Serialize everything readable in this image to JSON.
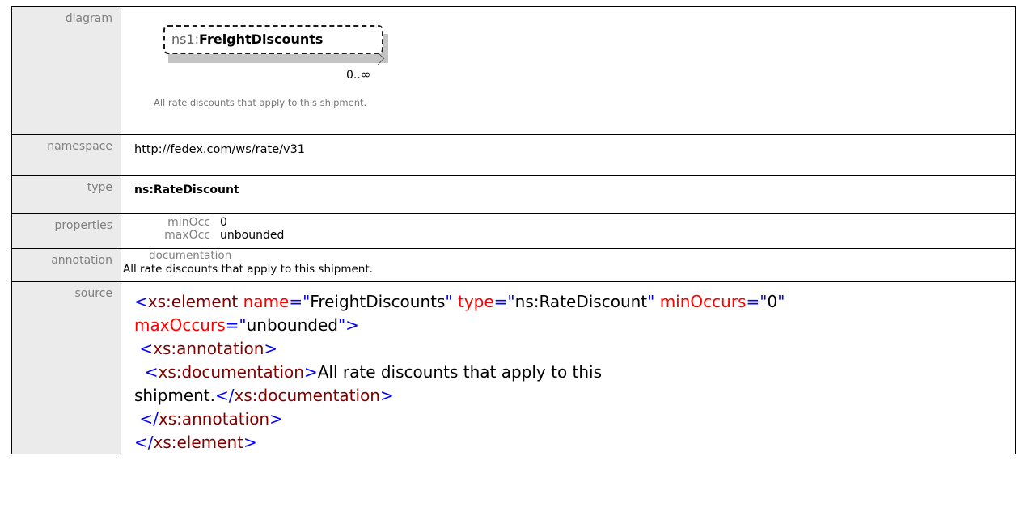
{
  "labels": {
    "diagram": "diagram",
    "namespace": "namespace",
    "type": "type",
    "properties": "properties",
    "annotation": "annotation",
    "source": "source"
  },
  "diagram": {
    "prefix": "ns1:",
    "name": "FreightDiscounts",
    "occurrence_min": "0..",
    "occurrence_max": "∞",
    "caption": "All rate discounts that apply to this shipment."
  },
  "namespace": "http://fedex.com/ws/rate/v31",
  "type": "ns:RateDiscount",
  "properties": {
    "minOcc_label": "minOcc",
    "minOcc_value": "0",
    "maxOcc_label": "maxOcc",
    "maxOcc_value": "unbounded"
  },
  "annotation": {
    "heading": "documentation",
    "text": "All rate discounts that apply to this shipment."
  },
  "source": {
    "element_open": "xs:element",
    "attr_name": "name",
    "val_name": "FreightDiscounts",
    "attr_type": "type",
    "val_type": "ns:RateDiscount",
    "attr_min": "minOccurs",
    "val_min": "0",
    "attr_max": "maxOccurs",
    "val_max": "unbounded",
    "annotation_tag": "xs:annotation",
    "documentation_tag": "xs:documentation",
    "doc_text_1": "All rate discounts that apply to this",
    "doc_text_2": "shipment."
  },
  "colors": {
    "tag_bracket": "#0000ff",
    "tag_name": "#800000",
    "attr_name": "#ff0000",
    "label_bg": "#ebebeb"
  }
}
